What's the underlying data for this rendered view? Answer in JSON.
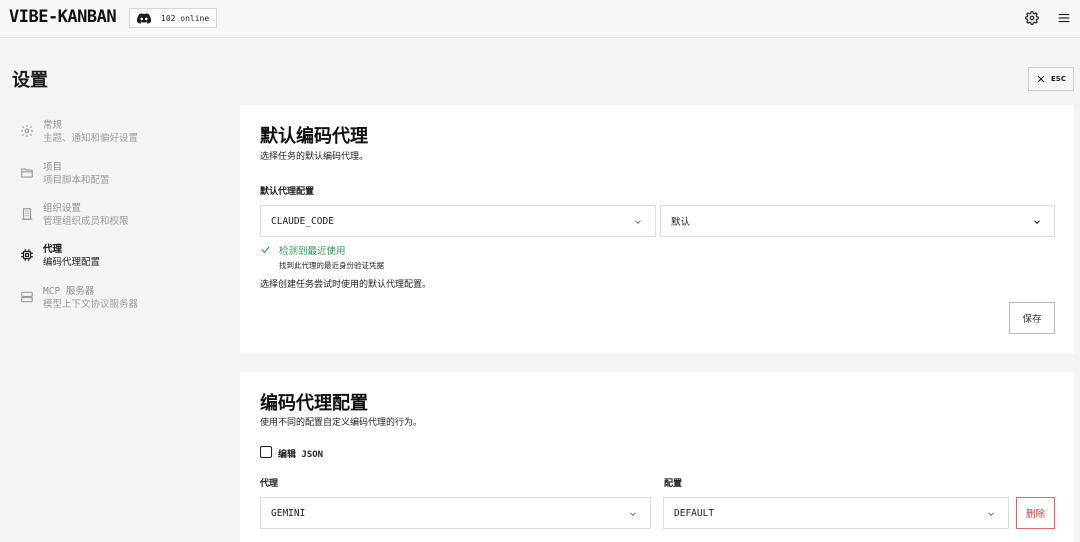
{
  "header": {
    "brand": "VIBE-KANBAN",
    "online": "102 online",
    "icons": [
      "discord-icon",
      "gear-icon",
      "menu-icon"
    ]
  },
  "page": {
    "title": "设置",
    "esc_label": "ESC"
  },
  "sidebar": {
    "items": [
      {
        "title": "常规",
        "sub": "主题、通知和偏好设置",
        "icon": "gear-icon",
        "active": false
      },
      {
        "title": "项目",
        "sub": "项目脚本和配置",
        "icon": "folder-icon",
        "active": false
      },
      {
        "title": "组织设置",
        "sub": "管理组织成员和权限",
        "icon": "building-icon",
        "active": false
      },
      {
        "title": "代理",
        "sub": "编码代理配置",
        "icon": "cpu-icon",
        "active": true
      },
      {
        "title": "MCP 服务器",
        "sub": "模型上下文协议服务器",
        "icon": "server-icon",
        "active": false
      }
    ]
  },
  "default_agent": {
    "title": "默认编码代理",
    "desc": "选择任务的默认编码代理。",
    "config_label": "默认代理配置",
    "agent_value": "CLAUDE_CODE",
    "variant_value": "默认",
    "detect_title": "检测到最近使用",
    "detect_sub": "找到此代理的最近身份验证凭据",
    "help": "选择创建任务尝试时使用的默认代理配置。",
    "save_label": "保存"
  },
  "agent_config": {
    "title": "编码代理配置",
    "desc": "使用不同的配置自定义编码代理的行为。",
    "edit_json_label": "编辑 JSON",
    "agent_label": "代理",
    "config_label": "配置",
    "agent_value": "GEMINI",
    "config_value": "DEFAULT",
    "delete_label": "删除"
  },
  "colors": {
    "success": "#2e9d4f",
    "danger": "#d83a3a",
    "background": "#f4f4f2"
  }
}
